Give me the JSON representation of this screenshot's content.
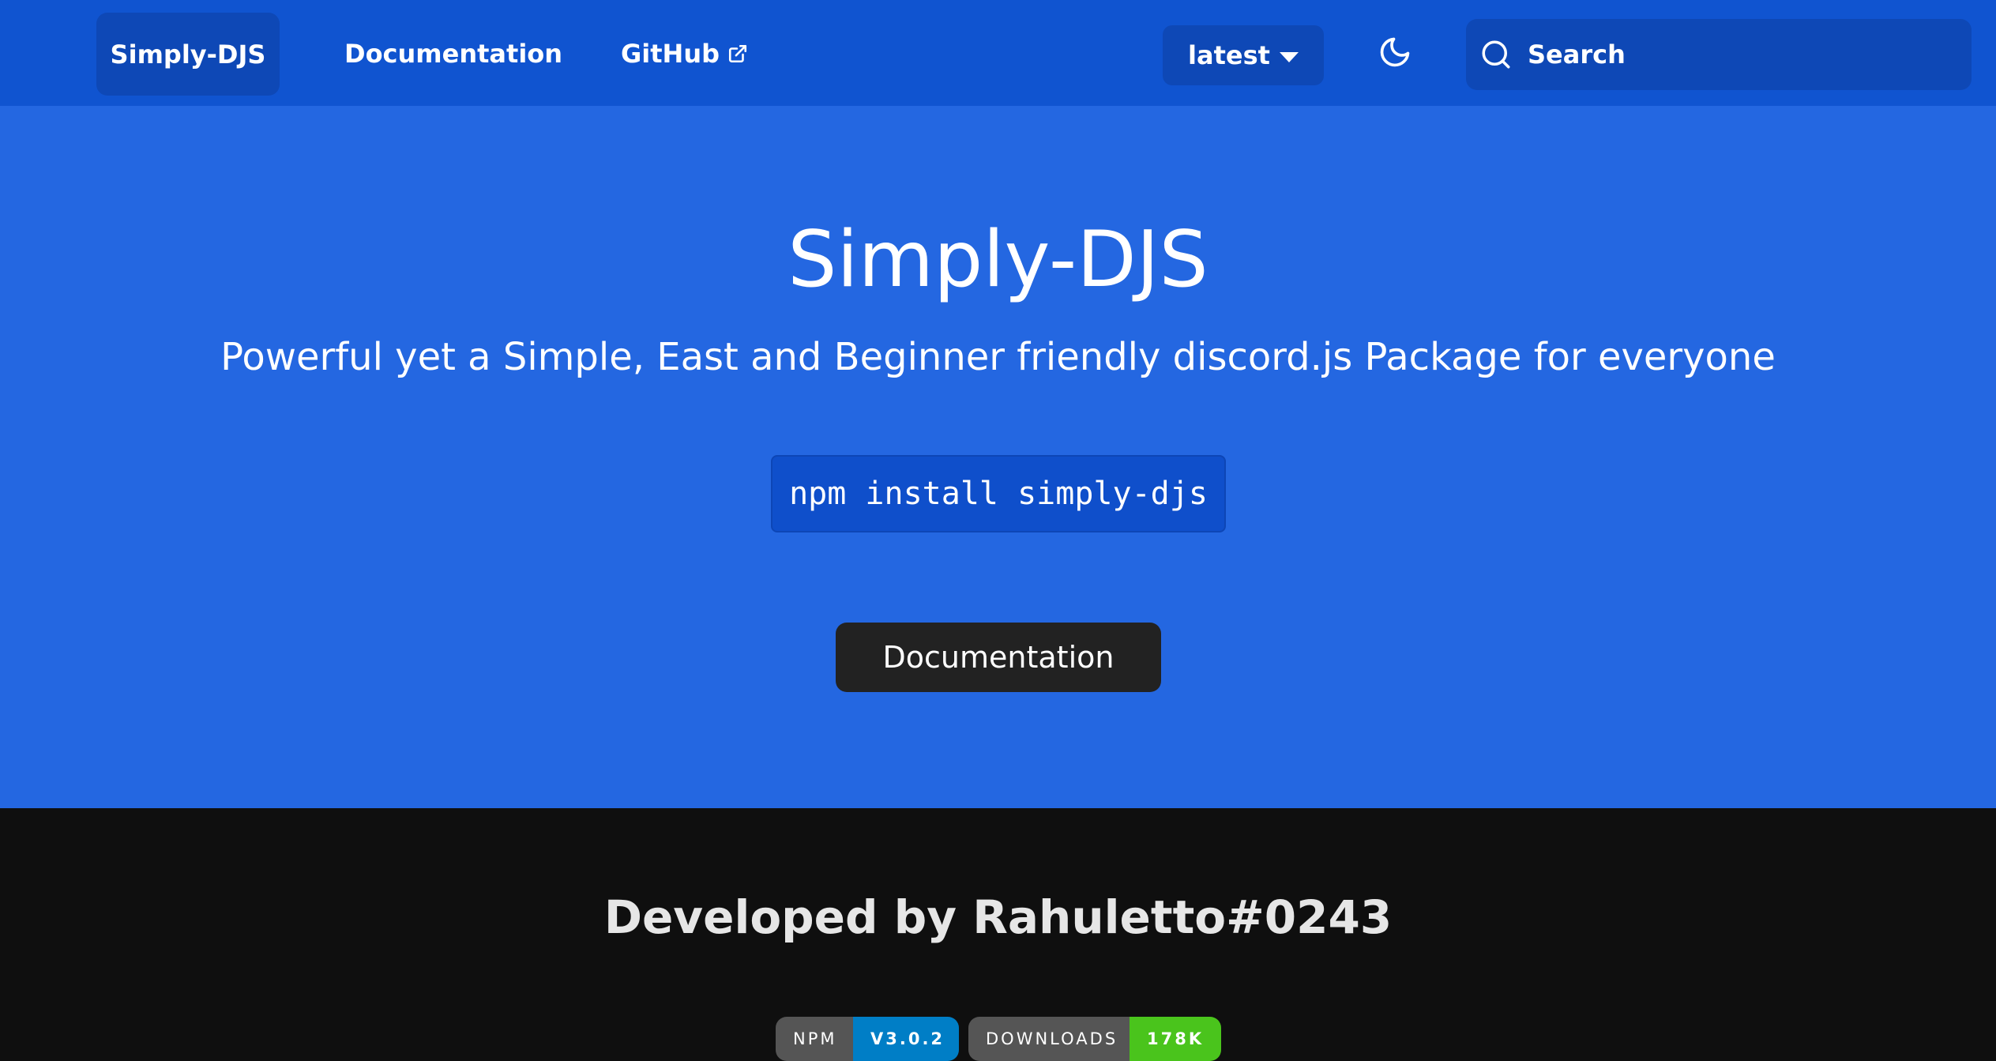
{
  "navbar": {
    "brand": "Simply-DJS",
    "links": {
      "documentation": "Documentation",
      "github": "GitHub"
    },
    "version": "latest",
    "search_placeholder": "Search",
    "icons": {
      "external": "external-link-icon",
      "caret": "caret-down-icon",
      "theme": "moon-icon",
      "search": "search-icon"
    }
  },
  "hero": {
    "title": "Simply-DJS",
    "subtitle": "Powerful yet a Simple, East and Beginner friendly discord.js Package for everyone",
    "install_command": "npm install simply-djs",
    "cta_label": "Documentation"
  },
  "footer": {
    "developer": "Developed by Rahuletto#0243",
    "badges": [
      {
        "label": "NPM",
        "value": "V3.0.2",
        "color": "#007ec6"
      },
      {
        "label": "DOWNLOADS",
        "value": "178K",
        "color": "#4ac41c"
      }
    ]
  },
  "colors": {
    "navbar": "#1054d0",
    "hero": "#2467e1",
    "footer": "#0f0f0f",
    "cta": "#222222"
  }
}
